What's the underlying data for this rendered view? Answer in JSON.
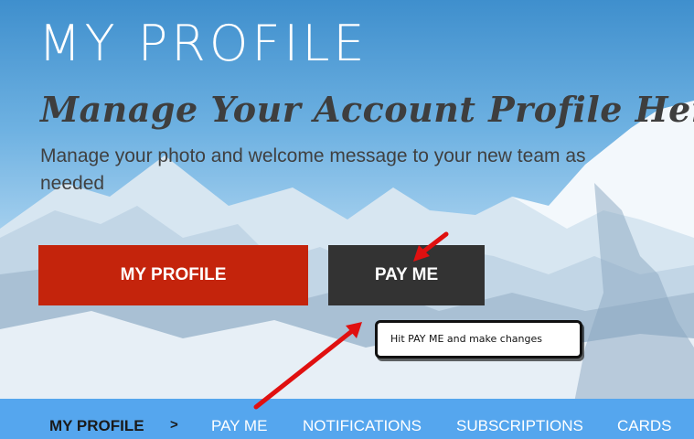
{
  "header": {
    "title": "MY PROFILE",
    "subtitle": "Manage Your Account Profile Here",
    "description": "Manage your photo and welcome message to your new team as needed"
  },
  "buttons": {
    "my_profile": "MY PROFILE",
    "pay_me": "PAY ME"
  },
  "callout": {
    "text": "Hit PAY ME and make changes"
  },
  "nav": {
    "items": [
      {
        "label": "MY PROFILE",
        "active": true
      },
      {
        "label": "PAY ME",
        "active": false
      },
      {
        "label": "NOTIFICATIONS",
        "active": false
      },
      {
        "label": "SUBSCRIPTIONS",
        "active": false
      },
      {
        "label": "CARDS",
        "active": false
      }
    ],
    "separator": ">"
  },
  "colors": {
    "profile_button": "#c4240c",
    "payme_button": "#333333",
    "nav_bar": "#55a6ee",
    "arrow": "#e01010"
  }
}
